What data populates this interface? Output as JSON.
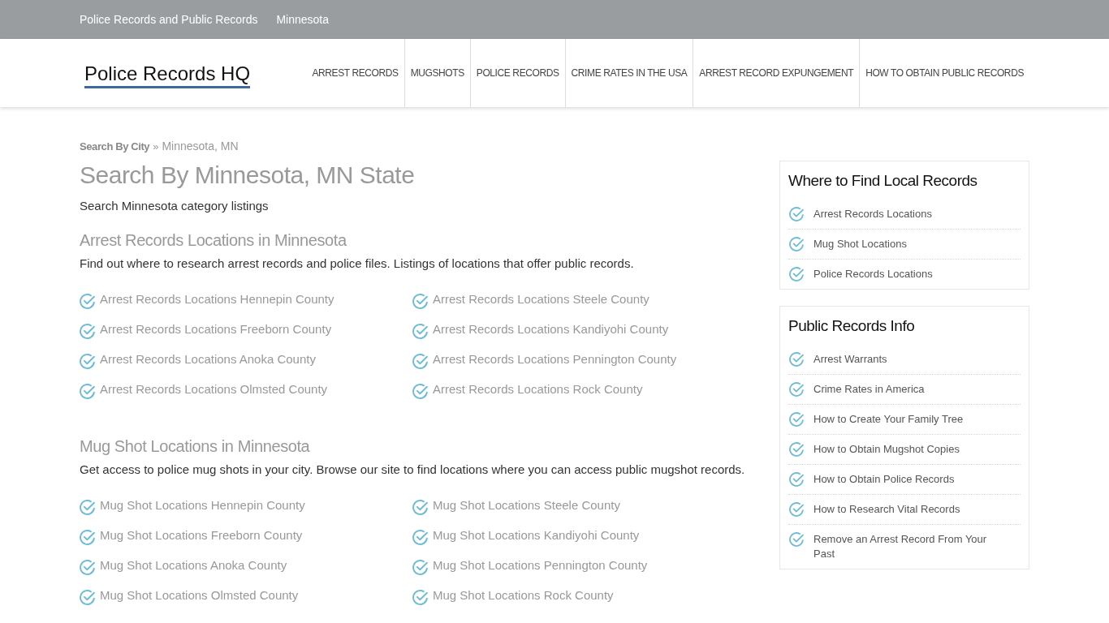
{
  "top_bar": {
    "links": [
      {
        "label": "Police Records and Public Records"
      },
      {
        "label": "Minnesota"
      }
    ]
  },
  "header": {
    "logo": "Police Records HQ",
    "nav": [
      {
        "label": "ARREST RECORDS"
      },
      {
        "label": "MUGSHOTS"
      },
      {
        "label": "POLICE RECORDS"
      },
      {
        "label": "CRIME RATES IN THE USA"
      },
      {
        "label": "ARREST RECORD EXPUNGEMENT"
      },
      {
        "label": "HOW TO OBTAIN PUBLIC RECORDS"
      }
    ]
  },
  "breadcrumb": {
    "items": [
      {
        "label": "Search By City",
        "kind": "link"
      },
      {
        "label": "Minnesota, MN",
        "kind": "current"
      }
    ],
    "separator": "»"
  },
  "page_title": "Search By Minnesota, MN State",
  "intro": "Search Minnesota category listings",
  "sections": [
    {
      "heading": "Arrest Records Locations in Minnesota",
      "description": "Find out where to research arrest records and police files. Listings of locations that offer public records.",
      "link_columns": [
        [
          "Arrest Records Locations Hennepin County",
          "Arrest Records Locations Freeborn County",
          "Arrest Records Locations Anoka County",
          "Arrest Records Locations Olmsted County"
        ],
        [
          "Arrest Records Locations Steele County",
          "Arrest Records Locations Kandiyohi County",
          "Arrest Records Locations Pennington County",
          "Arrest Records Locations Rock County"
        ]
      ]
    },
    {
      "heading": "Mug Shot Locations in Minnesota",
      "description": "Get access to police mug shots in your city. Browse our site to find locations where you can access public mugshot records.",
      "link_columns": [
        [
          "Mug Shot Locations Hennepin County",
          "Mug Shot Locations Freeborn County",
          "Mug Shot Locations Anoka County",
          "Mug Shot Locations Olmsted County"
        ],
        [
          "Mug Shot Locations Steele County",
          "Mug Shot Locations Kandiyohi County",
          "Mug Shot Locations Pennington County",
          "Mug Shot Locations Rock County"
        ]
      ]
    }
  ],
  "sidebar": {
    "widgets": [
      {
        "title": "Where to Find Local Records",
        "items": [
          "Arrest Records Locations",
          "Mug Shot Locations",
          "Police Records Locations"
        ]
      },
      {
        "title": "Public Records Info",
        "items": [
          "Arrest Warrants",
          "Crime Rates in America",
          "How to Create Your Family Tree",
          "How to Obtain Mugshot Copies",
          "How to Obtain Police Records",
          "How to Research Vital Records",
          "Remove an Arrest Record From Your Past"
        ]
      }
    ]
  }
}
